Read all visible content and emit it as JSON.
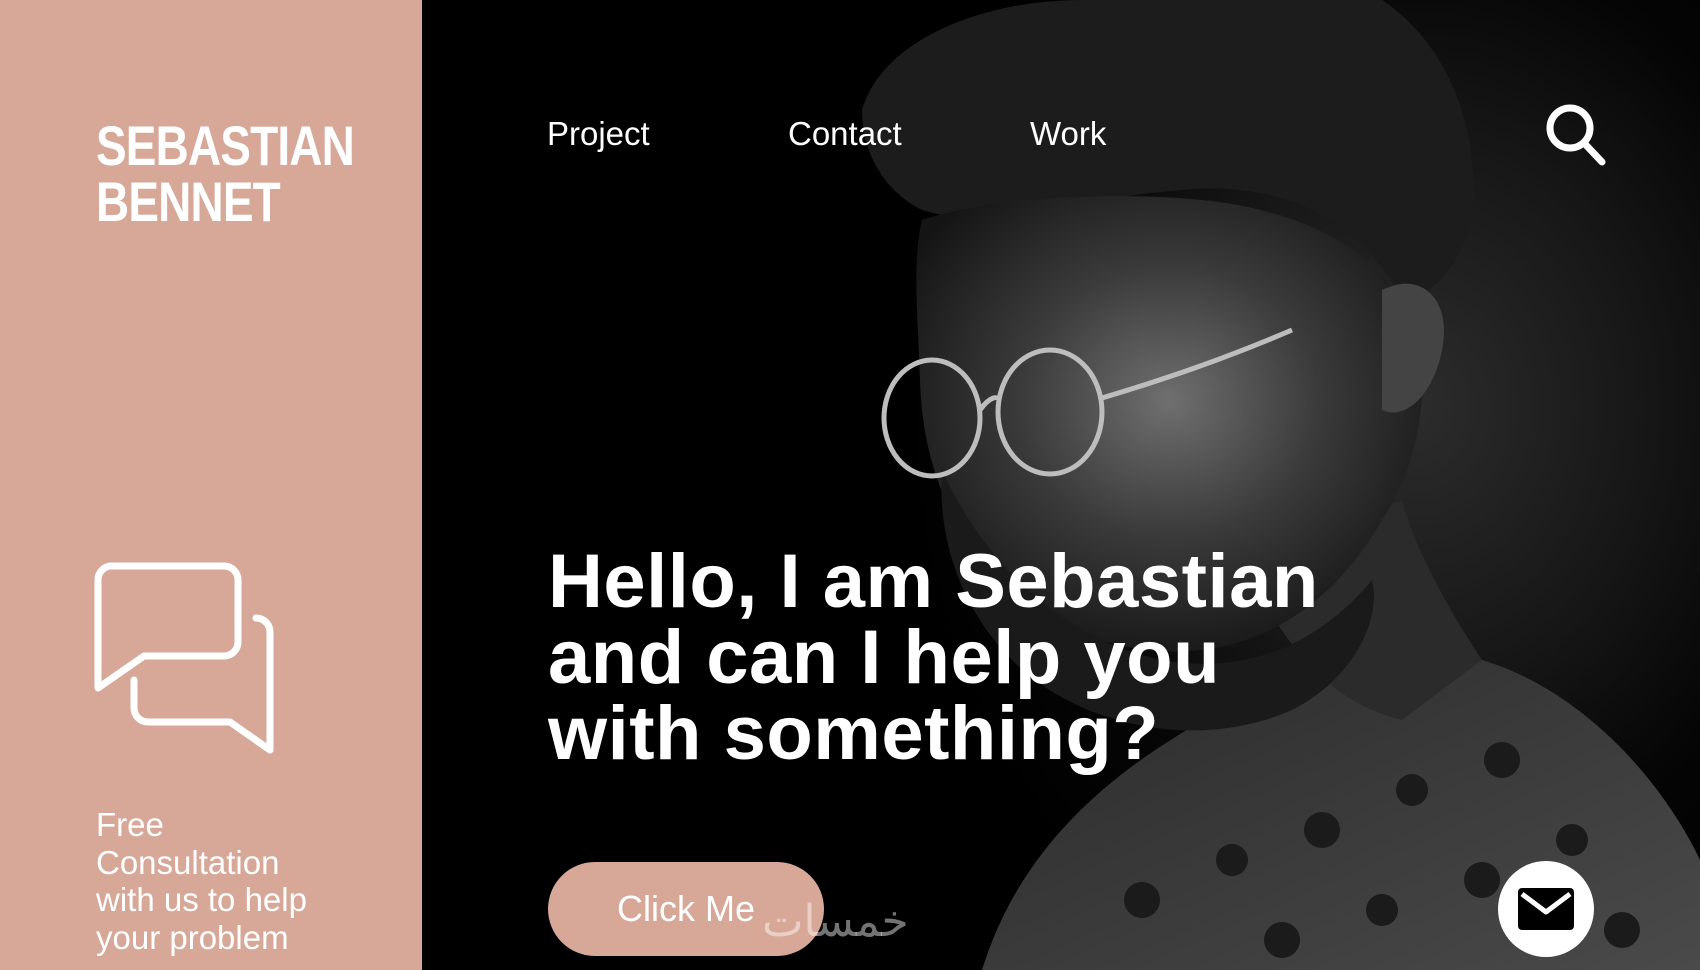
{
  "brand": {
    "line1": "SEBASTIAN",
    "line2": "BENNET"
  },
  "nav": {
    "items": [
      "Project",
      "Contact",
      "Work"
    ]
  },
  "sidebar": {
    "consult_lines": [
      "Free",
      "Consultation",
      "with us to help",
      "your problem"
    ]
  },
  "hero": {
    "headline_lines": [
      "Hello, I am Sebastian",
      "and can I help you",
      "with something?"
    ],
    "cta_label": "Click Me",
    "watermark": "خمسات"
  },
  "colors": {
    "accent": "#d7a898",
    "background": "#000000",
    "text": "#ffffff"
  },
  "icons": {
    "search": "search-icon",
    "chat": "chat-bubbles-icon",
    "mail": "mail-icon"
  }
}
